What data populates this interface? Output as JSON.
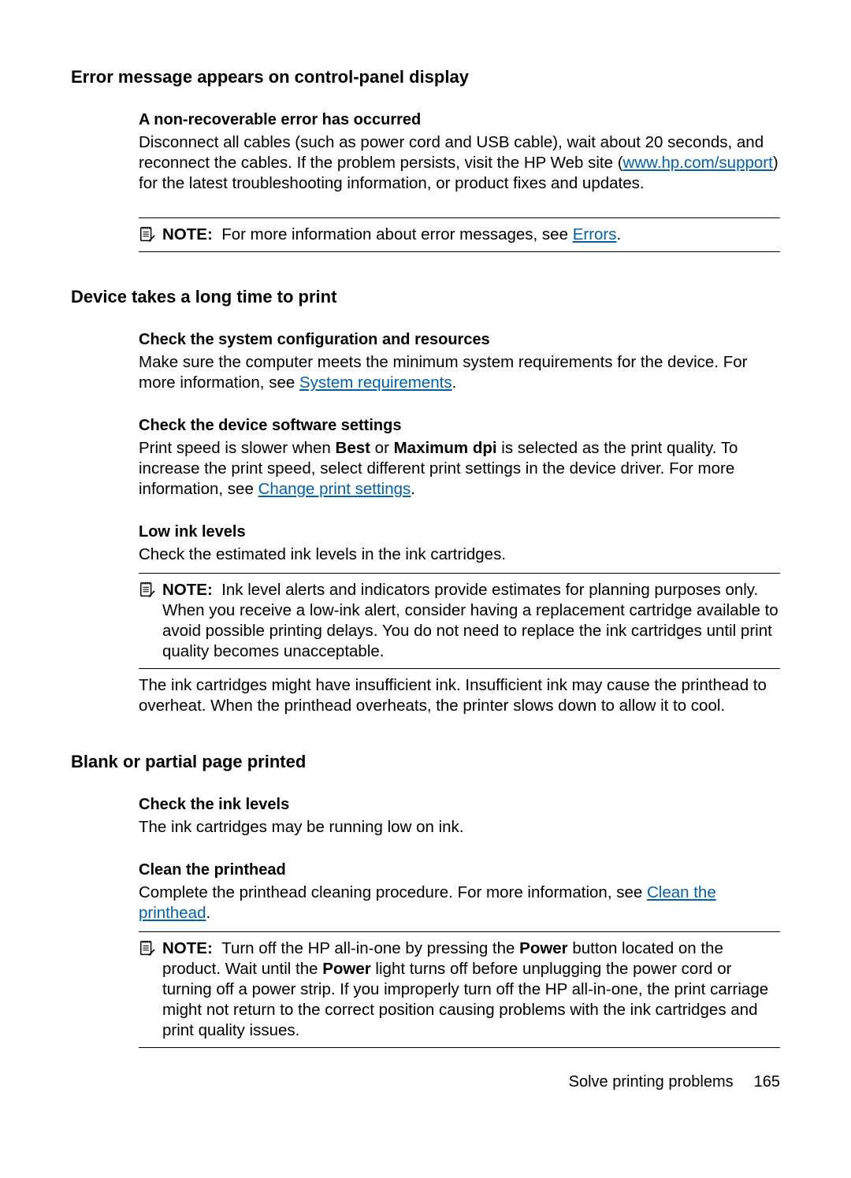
{
  "section1": {
    "title": "Error message appears on control-panel display",
    "sub1_title": "A non-recoverable error has occurred",
    "sub1_body_a": "Disconnect all cables (such as power cord and USB cable), wait about 20 seconds, and reconnect the cables. If the problem persists, visit the HP Web site (",
    "sub1_link": "www.hp.com/support",
    "sub1_body_b": ") for the latest troubleshooting information, or product fixes and updates.",
    "note1_label": "NOTE:",
    "note1_body_a": "For more information about error messages, see ",
    "note1_link": "Errors",
    "note1_body_b": "."
  },
  "section2": {
    "title": "Device takes a long time to print",
    "sub1_title": "Check the system configuration and resources",
    "sub1_body_a": "Make sure the computer meets the minimum system requirements for the device. For more information, see ",
    "sub1_link": "System requirements",
    "sub1_body_b": ".",
    "sub2_title": "Check the device software settings",
    "sub2_body_a": "Print speed is slower when ",
    "sub2_bold1": "Best",
    "sub2_body_b": " or ",
    "sub2_bold2": "Maximum dpi",
    "sub2_body_c": " is selected as the print quality. To increase the print speed, select different print settings in the device driver. For more information, see ",
    "sub2_link": "Change print settings",
    "sub2_body_d": ".",
    "sub3_title": "Low ink levels",
    "sub3_body": "Check the estimated ink levels in the ink cartridges.",
    "note2_label": "NOTE:",
    "note2_body": "Ink level alerts and indicators provide estimates for planning purposes only. When you receive a low-ink alert, consider having a replacement cartridge available to avoid possible printing delays. You do not need to replace the ink cartridges until print quality becomes unacceptable.",
    "after_note": "The ink cartridges might have insufficient ink. Insufficient ink may cause the printhead to overheat. When the printhead overheats, the printer slows down to allow it to cool."
  },
  "section3": {
    "title": "Blank or partial page printed",
    "sub1_title": "Check the ink levels",
    "sub1_body": "The ink cartridges may be running low on ink.",
    "sub2_title": "Clean the printhead",
    "sub2_body_a": "Complete the printhead cleaning procedure. For more information, see ",
    "sub2_link": "Clean the printhead",
    "sub2_body_b": ".",
    "note3_label": "NOTE:",
    "note3_body_a": "Turn off the HP all-in-one by pressing the ",
    "note3_bold1": "Power",
    "note3_body_b": " button located on the product. Wait until the ",
    "note3_bold2": "Power",
    "note3_body_c": " light turns off before unplugging the power cord or turning off a power strip. If you improperly turn off the HP all-in-one, the print carriage might not return to the correct position causing problems with the ink cartridges and print quality issues."
  },
  "footer": {
    "section": "Solve printing problems",
    "page": "165"
  }
}
